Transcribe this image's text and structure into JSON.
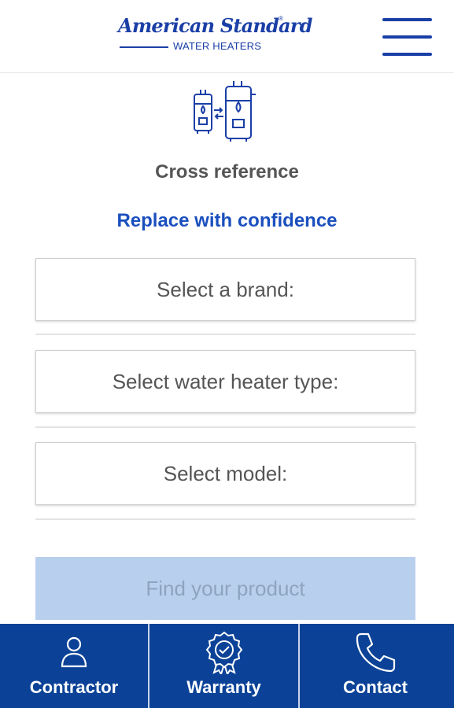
{
  "header": {
    "logo_script": "American Standard",
    "logo_reg": "®",
    "logo_sub": "WATER HEATERS",
    "menu_icon": "hamburger-menu-icon"
  },
  "hero": {
    "icon": "water-heater-swap-icon",
    "title": "Cross reference",
    "subtitle": "Replace with confidence"
  },
  "selects": {
    "brand_placeholder": "Select a brand:",
    "type_placeholder": "Select water heater type:",
    "model_placeholder": "Select model:"
  },
  "find_button": {
    "label": "Find your product"
  },
  "bottom_nav": {
    "items": [
      {
        "label": "Contractor",
        "icon": "person-icon"
      },
      {
        "label": "Warranty",
        "icon": "certificate-badge-icon"
      },
      {
        "label": "Contact",
        "icon": "phone-icon"
      }
    ]
  },
  "colors": {
    "brand_blue": "#1a3fa6",
    "link_blue": "#1a4fbe",
    "nav_bg": "#0b4297",
    "button_disabled_bg": "#b9cfee",
    "button_disabled_text": "#8ea3bf",
    "text_gray": "#555555"
  }
}
